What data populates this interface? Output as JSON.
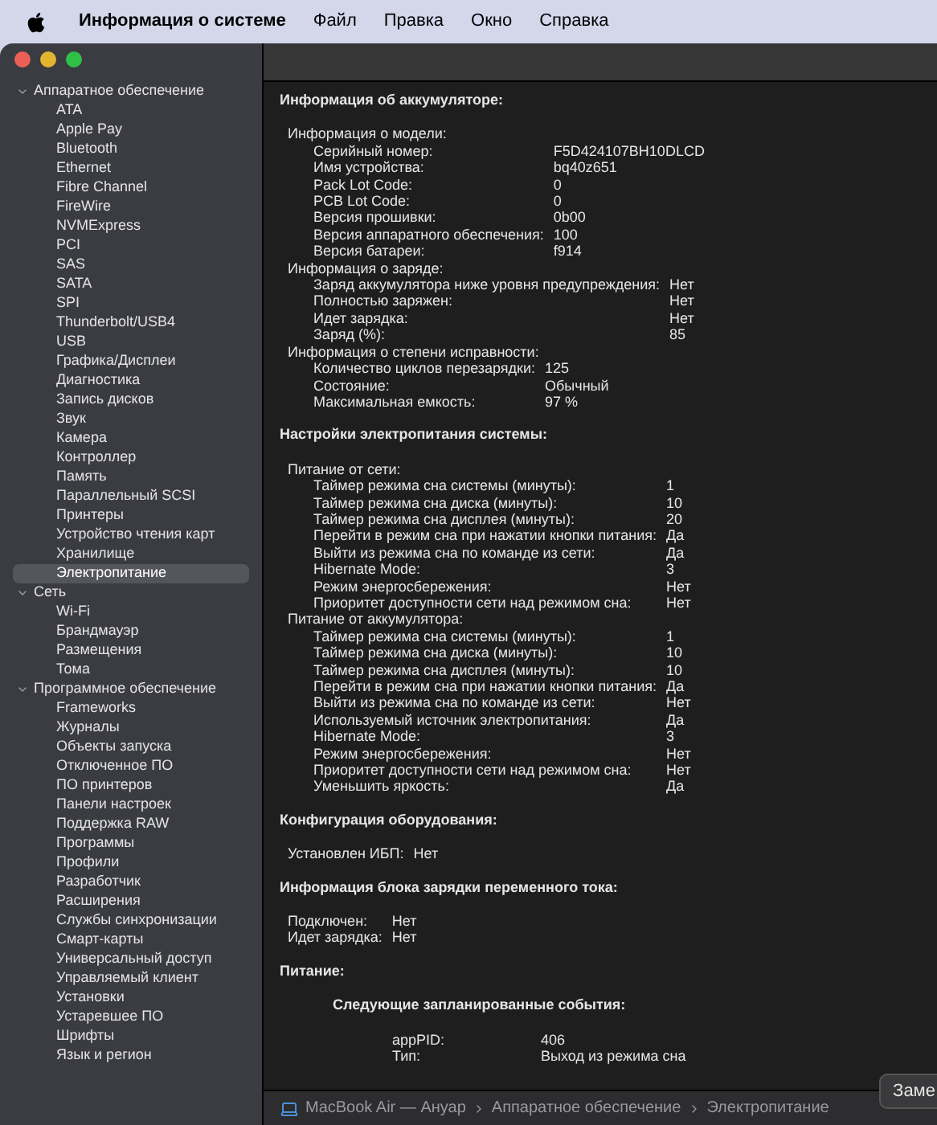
{
  "menubar": {
    "app_name": "Информация о системе",
    "items": [
      "Файл",
      "Правка",
      "Окно",
      "Справка"
    ]
  },
  "sidebar": {
    "groups": [
      {
        "label": "Аппаратное обеспечение",
        "expanded": true,
        "children": [
          {
            "label": "ATA",
            "selected": false
          },
          {
            "label": "Apple Pay",
            "selected": false
          },
          {
            "label": "Bluetooth",
            "selected": false
          },
          {
            "label": "Ethernet",
            "selected": false
          },
          {
            "label": "Fibre Channel",
            "selected": false
          },
          {
            "label": "FireWire",
            "selected": false
          },
          {
            "label": "NVMExpress",
            "selected": false
          },
          {
            "label": "PCI",
            "selected": false
          },
          {
            "label": "SAS",
            "selected": false
          },
          {
            "label": "SATA",
            "selected": false
          },
          {
            "label": "SPI",
            "selected": false
          },
          {
            "label": "Thunderbolt/USB4",
            "selected": false
          },
          {
            "label": "USB",
            "selected": false
          },
          {
            "label": "Графика/Дисплеи",
            "selected": false
          },
          {
            "label": "Диагностика",
            "selected": false
          },
          {
            "label": "Запись дисков",
            "selected": false
          },
          {
            "label": "Звук",
            "selected": false
          },
          {
            "label": "Камера",
            "selected": false
          },
          {
            "label": "Контроллер",
            "selected": false
          },
          {
            "label": "Память",
            "selected": false
          },
          {
            "label": "Параллельный SCSI",
            "selected": false
          },
          {
            "label": "Принтеры",
            "selected": false
          },
          {
            "label": "Устройство чтения карт",
            "selected": false
          },
          {
            "label": "Хранилище",
            "selected": false
          },
          {
            "label": "Электропитание",
            "selected": true
          }
        ]
      },
      {
        "label": "Сеть",
        "expanded": true,
        "children": [
          {
            "label": "Wi-Fi",
            "selected": false
          },
          {
            "label": "Брандмауэр",
            "selected": false
          },
          {
            "label": "Размещения",
            "selected": false
          },
          {
            "label": "Тома",
            "selected": false
          }
        ]
      },
      {
        "label": "Программное обеспечение",
        "expanded": true,
        "children": [
          {
            "label": "Frameworks",
            "selected": false
          },
          {
            "label": "Журналы",
            "selected": false
          },
          {
            "label": "Объекты запуска",
            "selected": false
          },
          {
            "label": "Отключенное ПО",
            "selected": false
          },
          {
            "label": "ПО принтеров",
            "selected": false
          },
          {
            "label": "Панели настроек",
            "selected": false
          },
          {
            "label": "Поддержка RAW",
            "selected": false
          },
          {
            "label": "Программы",
            "selected": false
          },
          {
            "label": "Профили",
            "selected": false
          },
          {
            "label": "Разработчик",
            "selected": false
          },
          {
            "label": "Расширения",
            "selected": false
          },
          {
            "label": "Службы синхронизации",
            "selected": false
          },
          {
            "label": "Смарт-карты",
            "selected": false
          },
          {
            "label": "Универсальный доступ",
            "selected": false
          },
          {
            "label": "Управляемый клиент",
            "selected": false
          },
          {
            "label": "Установки",
            "selected": false
          },
          {
            "label": "Устаревшее ПО",
            "selected": false
          },
          {
            "label": "Шрифты",
            "selected": false
          },
          {
            "label": "Язык и регион",
            "selected": false
          }
        ]
      }
    ]
  },
  "content": {
    "sections": [
      {
        "title": "Информация об аккумуляторе:",
        "kind": "groups",
        "groups": [
          {
            "label": "Информация о модели:",
            "children": [
              {
                "label": "Серийный номер:",
                "value": "F5D424107BH10DLCD"
              },
              {
                "label": "Имя устройства:",
                "value": "bq40z651"
              },
              {
                "label": "Pack Lot Code:",
                "value": "0"
              },
              {
                "label": "PCB Lot Code:",
                "value": "0"
              },
              {
                "label": "Версия прошивки:",
                "value": "0b00"
              },
              {
                "label": "Версия аппаратного обеспечения:",
                "value": "100"
              },
              {
                "label": "Версия батареи:",
                "value": "f914"
              }
            ]
          },
          {
            "label": "Информация о заряде:",
            "children": [
              {
                "label": "Заряд аккумулятора ниже уровня предупреждения:",
                "value": "Нет"
              },
              {
                "label": "Полностью заряжен:",
                "value": "Нет"
              },
              {
                "label": "Идет зарядка:",
                "value": "Нет"
              },
              {
                "label": "Заряд (%):",
                "value": "85"
              }
            ]
          },
          {
            "label": "Информация о степени исправности:",
            "children": [
              {
                "label": "Количество циклов перезарядки:",
                "value": "125"
              },
              {
                "label": "Состояние:",
                "value": "Обычный"
              },
              {
                "label": "Максимальная емкость:",
                "value": "97 %"
              }
            ]
          }
        ]
      },
      {
        "title": "Настройки электропитания системы:",
        "kind": "groups",
        "groups": [
          {
            "label": "Питание от сети:",
            "children": [
              {
                "label": "Таймер режима сна системы (минуты):",
                "value": "1"
              },
              {
                "label": "Таймер режима сна диска (минуты):",
                "value": "10"
              },
              {
                "label": "Таймер режима сна дисплея (минуты):",
                "value": "20"
              },
              {
                "label": "Перейти в режим сна при нажатии кнопки питания:",
                "value": "Да"
              },
              {
                "label": "Выйти из режима сна по команде из сети:",
                "value": "Да"
              },
              {
                "label": "Hibernate Mode:",
                "value": "3"
              },
              {
                "label": "Режим энергосбережения:",
                "value": "Нет"
              },
              {
                "label": "Приоритет доступности сети над режимом сна:",
                "value": "Нет"
              }
            ]
          },
          {
            "label": "Питание от аккумулятора:",
            "children": [
              {
                "label": "Таймер режима сна системы (минуты):",
                "value": "1"
              },
              {
                "label": "Таймер режима сна диска (минуты):",
                "value": "10"
              },
              {
                "label": "Таймер режима сна дисплея (минуты):",
                "value": "10"
              },
              {
                "label": "Перейти в режим сна при нажатии кнопки питания:",
                "value": "Да"
              },
              {
                "label": "Выйти из режима сна по команде из сети:",
                "value": "Нет"
              },
              {
                "label": "Используемый источник электропитания:",
                "value": "Да"
              },
              {
                "label": "Hibernate Mode:",
                "value": "3"
              },
              {
                "label": "Режим энергосбережения:",
                "value": "Нет"
              },
              {
                "label": "Приоритет доступности сети над режимом сна:",
                "value": "Нет"
              },
              {
                "label": "Уменьшить яркость:",
                "value": "Да"
              }
            ]
          }
        ]
      },
      {
        "title": "Конфигурация оборудования:",
        "kind": "pairs",
        "rows": [
          {
            "label": "Установлен ИБП:",
            "value": "Нет"
          }
        ]
      },
      {
        "title": "Информация блока зарядки переменного тока:",
        "kind": "pairs",
        "rows": [
          {
            "label": "Подключен:",
            "value": "Нет"
          },
          {
            "label": "Идет зарядка:",
            "value": "Нет"
          }
        ]
      },
      {
        "title": "Питание:",
        "kind": "events",
        "subtitle": "Следующие запланированные события:",
        "rows": [
          {
            "label": "appPID:",
            "value": "406"
          },
          {
            "label": "Тип:",
            "value": "Выход из режима сна"
          }
        ]
      }
    ]
  },
  "status_bar": {
    "path": [
      "MacBook Air — Ануар",
      "Аппаратное обеспечение",
      "Электропитание"
    ]
  },
  "overlay_button": {
    "label": "Заме"
  }
}
